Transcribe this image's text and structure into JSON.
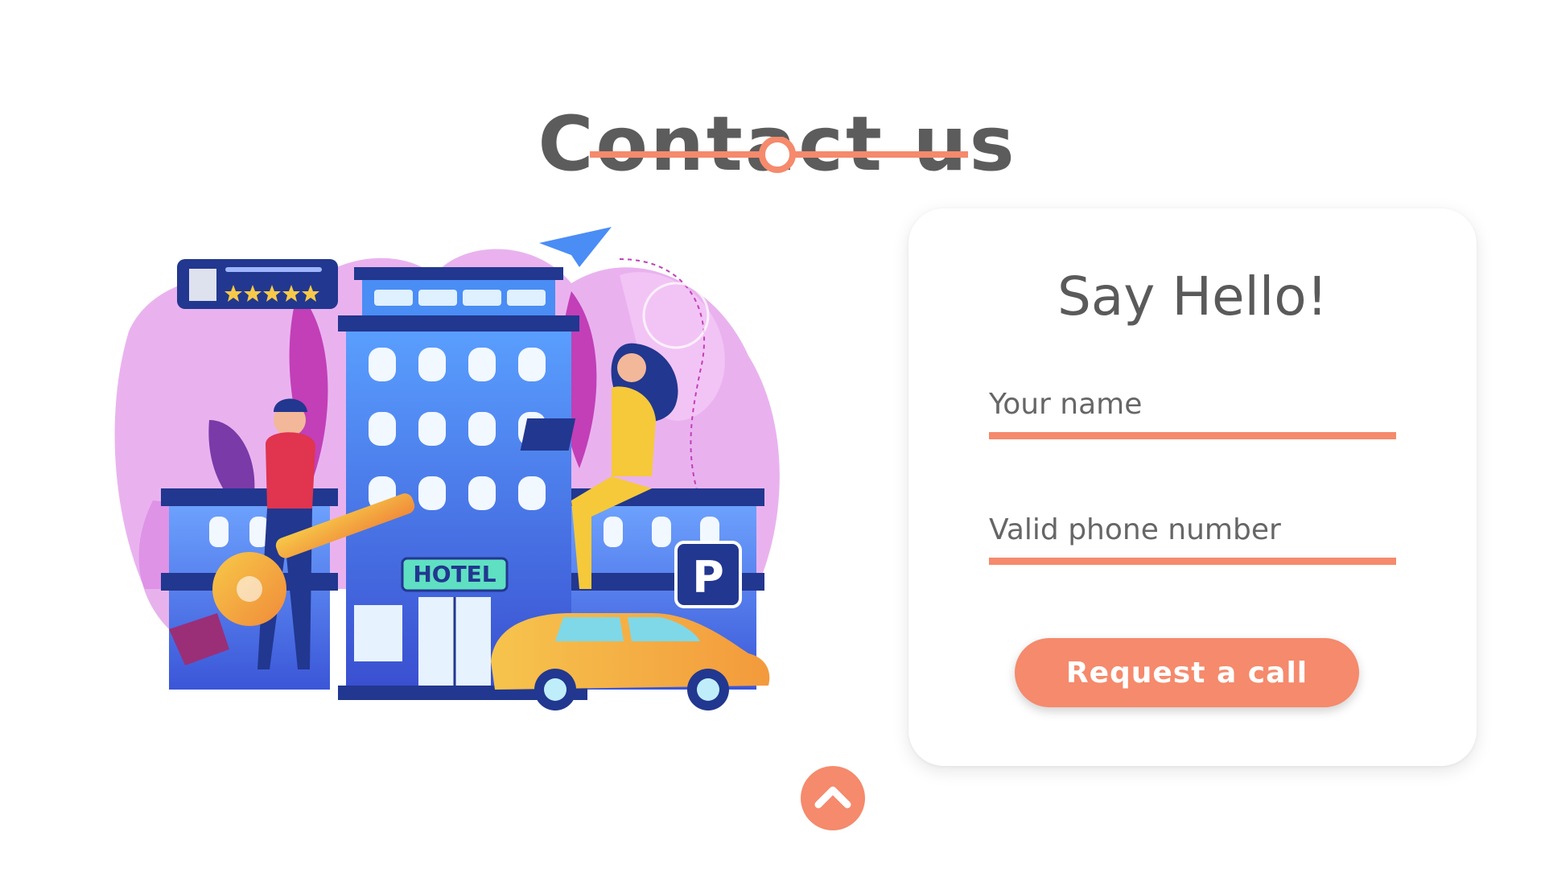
{
  "header": {
    "title": "Contact us"
  },
  "illustration": {
    "hotel_sign": "HOTEL",
    "parking_sign": "P",
    "rating_stars": 5
  },
  "form": {
    "title": "Say Hello!",
    "name_placeholder": "Your name",
    "phone_placeholder": "Valid phone number",
    "submit_label": "Request a call"
  },
  "icons": {
    "scroll_top": "chevron-up-icon",
    "divider": "circle-divider-icon"
  },
  "colors": {
    "accent": "#f58a6c",
    "title_text": "#5c5c5c",
    "hotel_blue": "#3b6ee0",
    "background_pink": "#e6a9ee",
    "car_yellow": "#f5b94a"
  }
}
